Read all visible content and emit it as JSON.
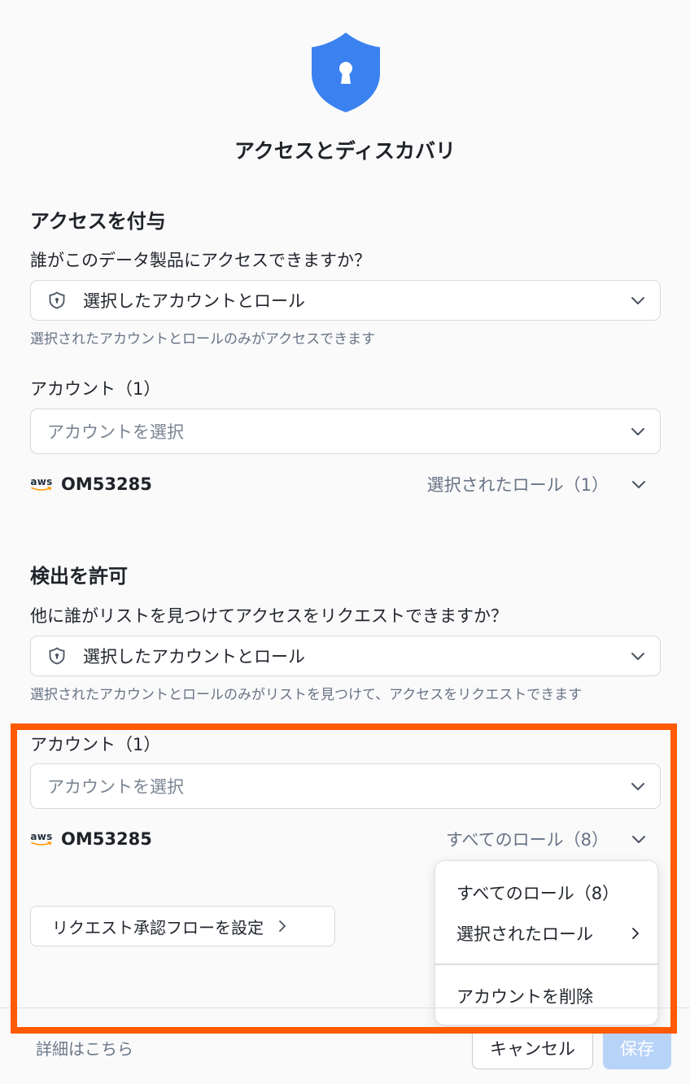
{
  "dialog": {
    "title": "アクセスとディスカバリ",
    "icon": "shield-keyhole-icon",
    "accent_color": "#3b82f0"
  },
  "grant_access": {
    "section_title": "アクセスを付与",
    "question": "誰がこのデータ製品にアクセスできますか？",
    "select_value": "選択したアカウントとロール",
    "helper": "選択されたアカウントとロールのみがアクセスできます",
    "accounts_label": "アカウント（1）",
    "account_select_placeholder": "アカウントを選択",
    "account": {
      "provider": "aws",
      "id": "OM53285",
      "role_selector": "選択されたロール（1）"
    }
  },
  "allow_discovery": {
    "section_title": "検出を許可",
    "question": "他に誰がリストを見つけてアクセスをリクエストできますか？",
    "select_value": "選択したアカウントとロール",
    "helper": "選択されたアカウントとロールのみがリストを見つけて、アクセスをリクエストできます",
    "accounts_label": "アカウント（1）",
    "account_select_placeholder": "アカウントを選択",
    "account": {
      "provider": "aws",
      "id": "OM53285",
      "role_selector": "すべてのロール（8）"
    },
    "approval_flow_button": "リクエスト承認フローを設定"
  },
  "role_menu": {
    "items": [
      {
        "label": "すべてのロール（8）"
      },
      {
        "label": "選択されたロール"
      },
      {
        "label": "アカウントを削除"
      }
    ]
  },
  "footer": {
    "learn_more": "詳細はこちら",
    "cancel": "キャンセル",
    "save": "保存"
  },
  "highlight_color": "#ff5a00"
}
